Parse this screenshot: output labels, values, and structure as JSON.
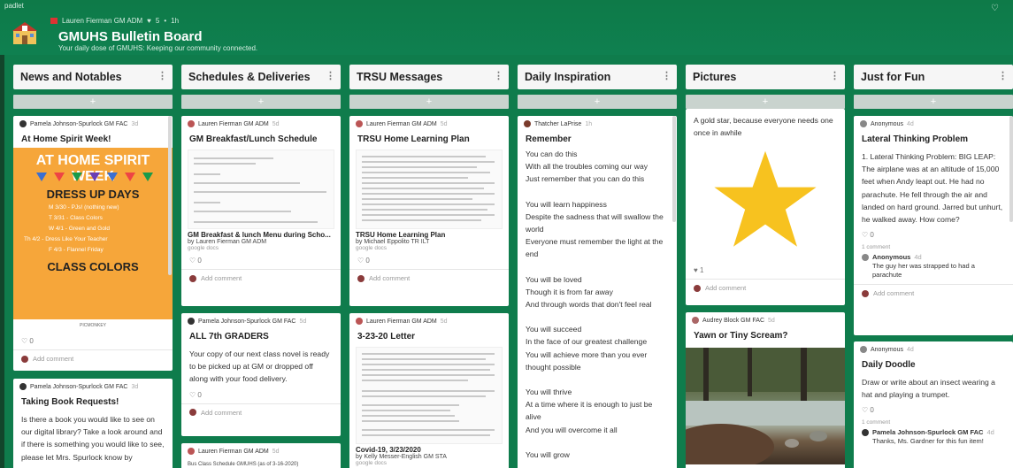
{
  "app": {
    "padlet_label": "padlet"
  },
  "header": {
    "author": "Lauren Fierman GM ADM",
    "likes": "5",
    "age": "1h",
    "title": "GMUHS Bulletin Board",
    "subtitle": "Your daily dose of GMUHS: Keeping our community connected."
  },
  "columns": [
    {
      "title": "News and Notables"
    },
    {
      "title": "Schedules & Deliveries"
    },
    {
      "title": "TRSU Messages"
    },
    {
      "title": "Daily Inspiration"
    },
    {
      "title": "Pictures"
    },
    {
      "title": "Just for Fun"
    }
  ],
  "add_label": "+",
  "posts": {
    "news1": {
      "author": "Pamela Johnson-Spurlock GM FAC",
      "age": "3d",
      "title": "At Home Spirit Week!",
      "poster": {
        "heading": "AT HOME SPIRIT WEEK",
        "dress": "DRESS UP DAYS",
        "days": [
          "M 3/30 - PJs! (nothing new)",
          "T 3/31 - Class Colors",
          "W 4/1 - Green and Gold",
          "Th 4/2 - Dress Like Your Teacher",
          "F 4/3 - Flannel Friday"
        ],
        "colors": "CLASS COLORS",
        "brand": "PICMONKEY"
      },
      "likes": "0",
      "add_comment": "Add comment"
    },
    "news2": {
      "author": "Pamela Johnson-Spurlock GM FAC",
      "age": "3d",
      "title": "Taking Book Requests!",
      "body": "Is there a book you would like to see on our digital library? Take a look around and if there is something you would like to see, please let Mrs. Spurlock know by"
    },
    "sched1": {
      "author": "Lauren Fierman GM ADM",
      "age": "5d",
      "title": "GM Breakfast/Lunch Schedule",
      "att_title": "GM Breakfast & lunch Menu during Scho...",
      "att_sub": "by Lauren Fierman GM ADM",
      "att_src": "google docs",
      "likes": "0",
      "add_comment": "Add comment"
    },
    "sched2": {
      "author": "Pamela Johnson-Spurlock GM FAC",
      "age": "5d",
      "title": "ALL 7th GRADERS",
      "body": "Your copy of our next class novel is ready to be picked up at GM or dropped off along with your food delivery.",
      "likes": "0",
      "add_comment": "Add comment"
    },
    "sched3": {
      "author": "Lauren Fierman GM ADM",
      "age": "5d",
      "att_title": "Bus Class Schedule GMUHS (as of 3-16-2020)"
    },
    "trsu1": {
      "author": "Lauren Fierman GM ADM",
      "age": "5d",
      "title": "TRSU Home Learning Plan",
      "att_title": "TRSU Home Learning Plan",
      "att_sub": "by Michael Eppolito TR ILT",
      "att_src": "google docs",
      "likes": "0",
      "add_comment": "Add comment"
    },
    "trsu2": {
      "author": "Lauren Fierman GM ADM",
      "age": "5d",
      "title": "3-23-20 Letter",
      "att_title": "Covid-19, 3/23/2020",
      "att_sub": "by Kelly Messer-English GM STA",
      "att_src": "google docs"
    },
    "insp1": {
      "author": "Thatcher LaPrise",
      "age": "1h",
      "title": "Remember",
      "lines": [
        "You can do this",
        "With all the troubles coming our way",
        "Just remember that you can do this",
        "",
        "You will learn happiness",
        "Despite the sadness that will swallow the world",
        "Everyone must remember the light at the end",
        "",
        "You will be loved",
        "Though it is from far away",
        "And through words that don't feel real",
        "",
        "You will succeed",
        "In the face of our greatest challenge",
        "You will achieve more than you ever thought possible",
        "",
        "You will thrive",
        "At a time where it is enough to just be alive",
        "And you will overcome it all",
        "",
        "You will grow"
      ]
    },
    "pic1": {
      "caption": "A gold star, because everyone needs one once in awhile",
      "likes": "1",
      "add_comment": "Add comment"
    },
    "pic2": {
      "author": "Audrey Block GM FAC",
      "age": "5d",
      "title": "Yawn or Tiny Scream?"
    },
    "fun1": {
      "author": "Anonymous",
      "age": "4d",
      "title": "Lateral Thinking Problem",
      "body": "1. Lateral Thinking Problem: BIG LEAP: The airplane was at an altitude of 15,000 feet when Andy leapt out. He had no parachute. He fell through the air and landed on hard ground. Jarred but unhurt, he walked away. How come?",
      "likes": "0",
      "comment_count": "1 comment",
      "comment_author": "Anonymous",
      "comment_age": "4d",
      "comment_text": "The guy her was strapped to had a parachute",
      "add_comment": "Add comment"
    },
    "fun2": {
      "author": "Anonymous",
      "age": "4d",
      "title": "Daily Doodle",
      "body": "Draw or write about an insect wearing a hat and playing a trumpet.",
      "likes": "0",
      "comment_count": "1 comment",
      "comment_author": "Pamela Johnson-Spurlock GM FAC",
      "comment_age": "4d",
      "comment_text": "Thanks, Ms. Gardner for this fun item!"
    }
  },
  "colors": {
    "background": "#0f7c4c",
    "star": "#f7c21f",
    "poster": "#f6a63a"
  }
}
